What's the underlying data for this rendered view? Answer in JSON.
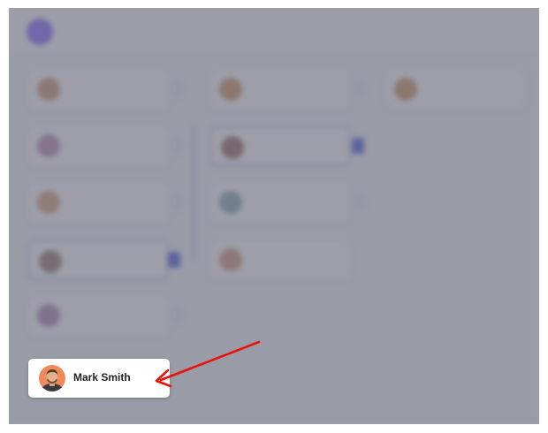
{
  "colors": {
    "accent": "#3d4ed8",
    "logo": "#7b54ff",
    "annotation_arrow": "#e8140c"
  },
  "focused_card": {
    "name": "Mark Smith",
    "avatar": "avatar-mark-smith"
  }
}
